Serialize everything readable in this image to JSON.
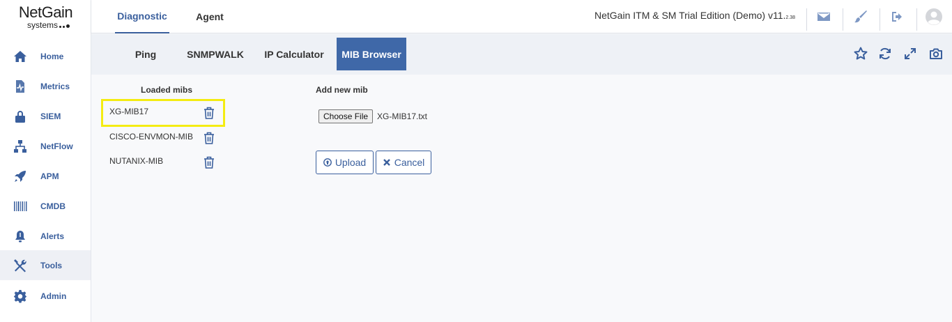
{
  "logo": {
    "brand": "NetGain",
    "sub": "systems"
  },
  "sidebar": {
    "items": [
      {
        "label": "Home",
        "icon": "home-icon"
      },
      {
        "label": "Metrics",
        "icon": "metrics-icon"
      },
      {
        "label": "SIEM",
        "icon": "lock-icon"
      },
      {
        "label": "NetFlow",
        "icon": "network-icon"
      },
      {
        "label": "APM",
        "icon": "rocket-icon"
      },
      {
        "label": "CMDB",
        "icon": "barcode-icon"
      },
      {
        "label": "Alerts",
        "icon": "bell-icon"
      },
      {
        "label": "Tools",
        "icon": "tools-icon",
        "active": true
      },
      {
        "label": "Admin",
        "icon": "gear-icon"
      }
    ]
  },
  "topbar": {
    "tabs": [
      {
        "label": "Diagnostic",
        "active": true
      },
      {
        "label": "Agent",
        "active": false
      }
    ],
    "edition": "NetGain ITM & SM Trial Edition (Demo) v11.",
    "version_minor": "2.38",
    "icons": [
      "mail-icon",
      "brush-icon",
      "logout-icon",
      "user-avatar-icon"
    ]
  },
  "subnav": {
    "tabs": [
      {
        "label": "Ping",
        "active": false
      },
      {
        "label": "SNMPWALK",
        "active": false
      },
      {
        "label": "IP Calculator",
        "active": false
      },
      {
        "label": "MIB Browser",
        "active": true
      }
    ],
    "tools": [
      "star-icon",
      "refresh-icon",
      "expand-icon",
      "camera-icon"
    ]
  },
  "content": {
    "loaded_heading": "Loaded mibs",
    "add_heading": "Add new mib",
    "mibs": [
      "XG-MIB17",
      "CISCO-ENVMON-MIB",
      "NUTANIX-MIB"
    ],
    "choose_file_label": "Choose File",
    "file_name": "XG-MIB17.txt",
    "upload_label": "Upload",
    "cancel_label": "Cancel"
  },
  "colors": {
    "accent": "#3a5f9d",
    "active_tab": "#3f68a8",
    "highlight": "#f4ec12"
  }
}
